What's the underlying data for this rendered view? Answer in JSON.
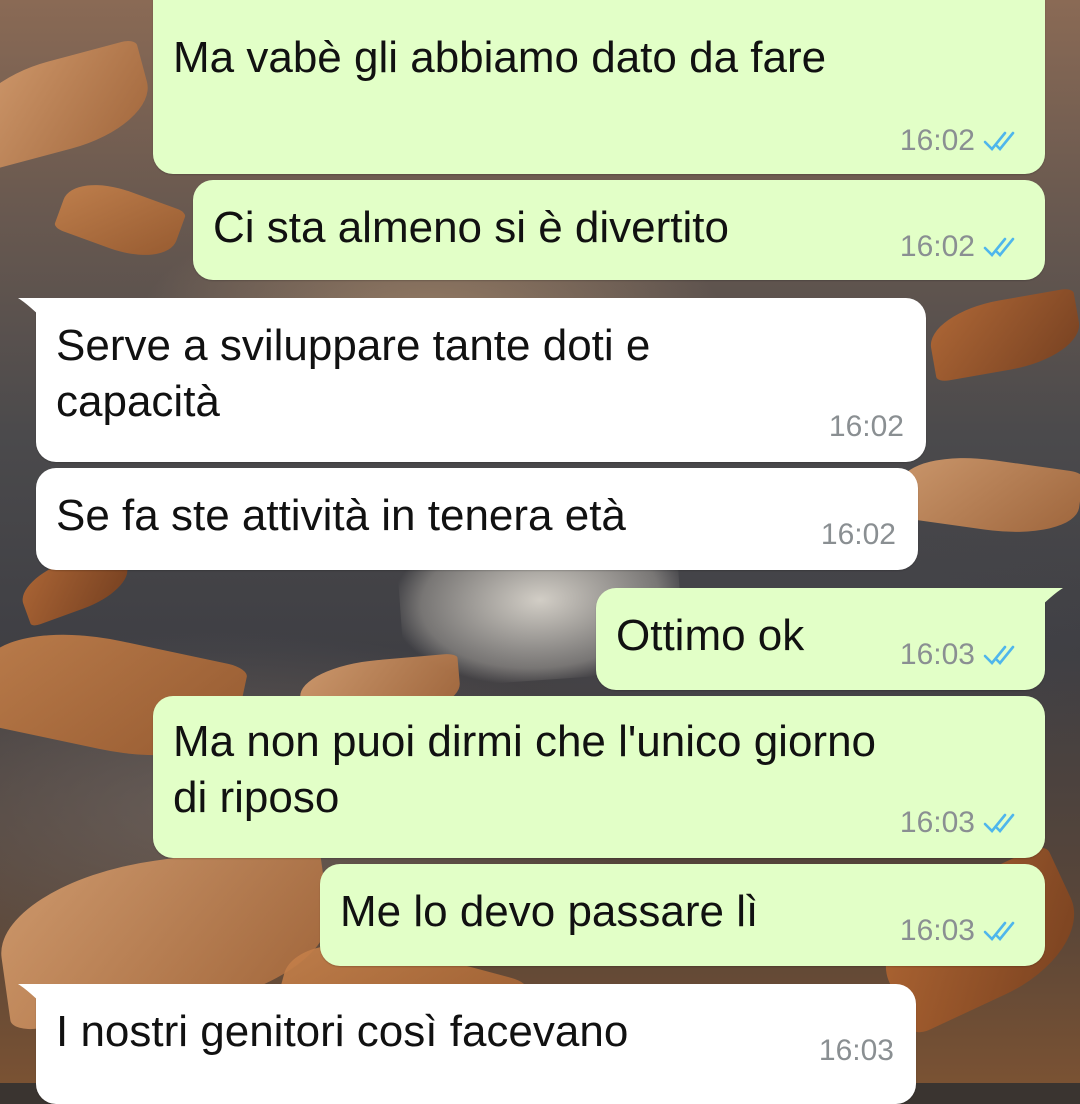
{
  "messages": [
    {
      "direction": "out",
      "text": "Ma vabè gli abbiamo dato da fare",
      "time": "16:02",
      "status": "read"
    },
    {
      "direction": "out",
      "text": "Ci sta almeno si è divertito",
      "time": "16:02",
      "status": "read"
    },
    {
      "direction": "in",
      "text": "Serve a sviluppare tante doti e\ncapacità",
      "time": "16:02"
    },
    {
      "direction": "in",
      "text": "Se fa ste attività in tenera età",
      "time": "16:02"
    },
    {
      "direction": "out",
      "text": "Ottimo ok",
      "time": "16:03",
      "status": "read"
    },
    {
      "direction": "out",
      "text": "Ma non puoi dirmi che l'unico giorno\ndi riposo",
      "time": "16:03",
      "status": "read"
    },
    {
      "direction": "out",
      "text": "Me lo devo passare lì",
      "time": "16:03",
      "status": "read"
    },
    {
      "direction": "in",
      "text": "I nostri genitori così facevano",
      "time": "16:03"
    }
  ],
  "colors": {
    "outgoing_bubble": "#e2ffc7",
    "incoming_bubble": "#ffffff",
    "read_ticks": "#4fb6ec",
    "timestamp": "#8a8f92"
  },
  "icons": {
    "read_receipt": "double-check-icon"
  }
}
